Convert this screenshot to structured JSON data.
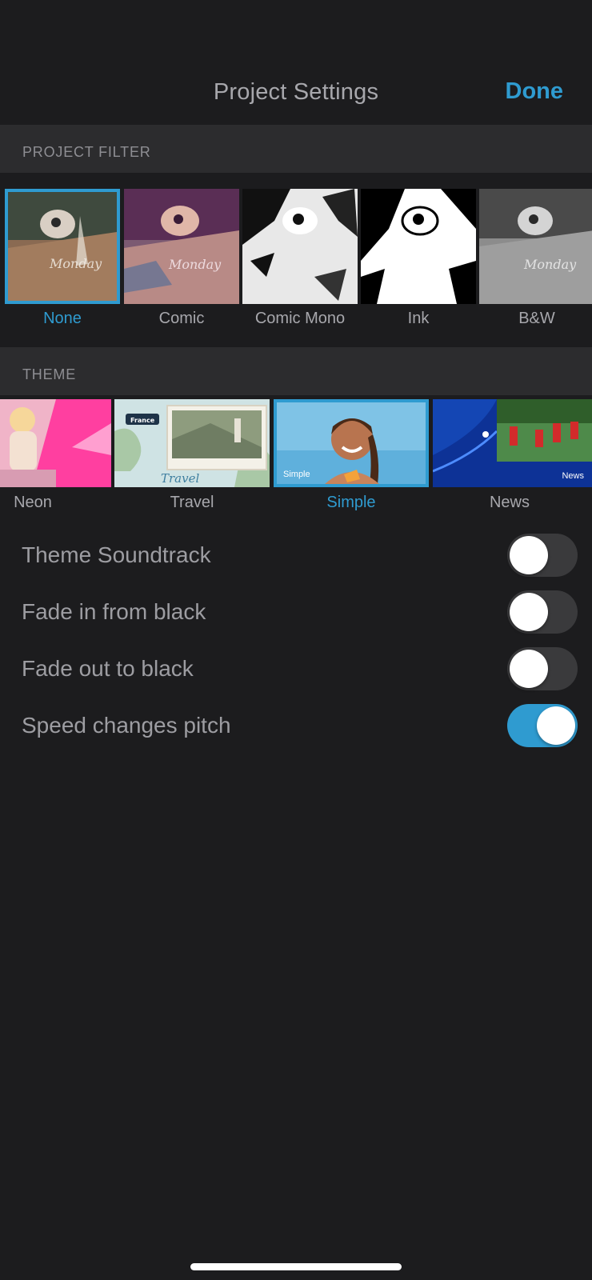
{
  "header": {
    "title": "Project Settings",
    "done_label": "Done"
  },
  "project_filter": {
    "section_label": "PROJECT FILTER",
    "selected": "None",
    "items": [
      {
        "label": "None",
        "selected": true
      },
      {
        "label": "Comic",
        "selected": false
      },
      {
        "label": "Comic Mono",
        "selected": false
      },
      {
        "label": "Ink",
        "selected": false
      },
      {
        "label": "B&W",
        "selected": false
      }
    ]
  },
  "theme": {
    "section_label": "THEME",
    "selected": "Simple",
    "items": [
      {
        "label": "Neon",
        "selected": false
      },
      {
        "label": "Travel",
        "selected": false,
        "thumb_caption": "Travel"
      },
      {
        "label": "Simple",
        "selected": true,
        "thumb_caption": "Simple"
      },
      {
        "label": "News",
        "selected": false,
        "thumb_caption": "News"
      }
    ]
  },
  "settings": [
    {
      "label": "Theme Soundtrack",
      "on": false
    },
    {
      "label": "Fade in from black",
      "on": false
    },
    {
      "label": "Fade out to black",
      "on": false
    },
    {
      "label": "Speed changes pitch",
      "on": true
    }
  ],
  "colors": {
    "background": "#1c1c1e",
    "section_header": "#2c2c2e",
    "accent": "#2f9bd0",
    "toggle_off": "#3a3a3c",
    "text": "#9d9da2"
  }
}
